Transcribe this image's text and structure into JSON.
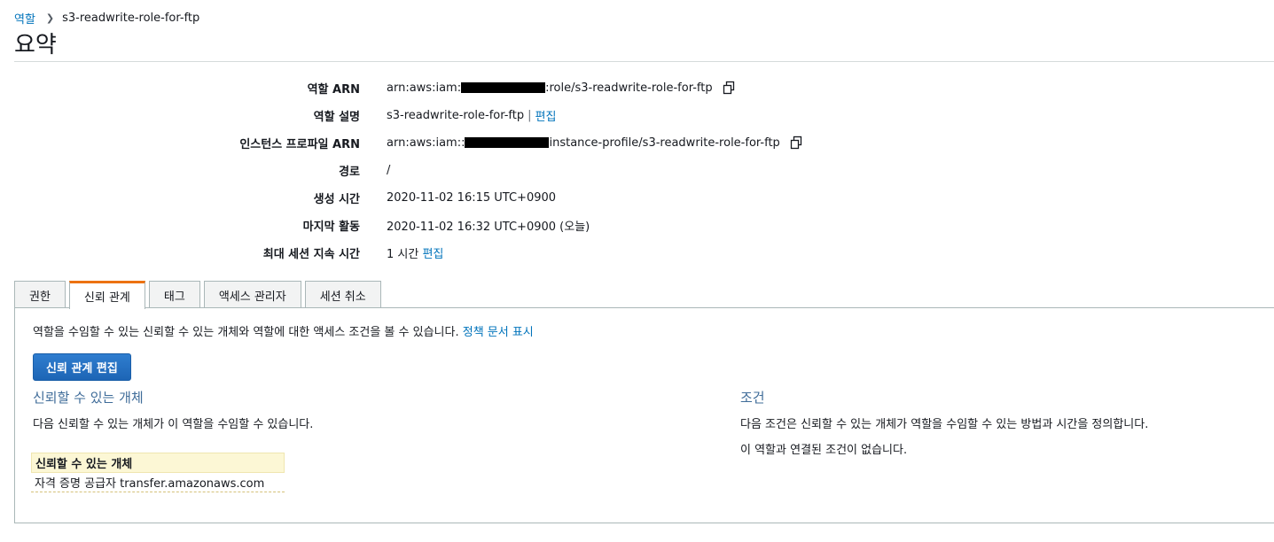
{
  "breadcrumb": {
    "parent": "역할",
    "current": "s3-readwrite-role-for-ftp"
  },
  "page_title": "요약",
  "summary": {
    "role_arn": {
      "label": "역할 ARN",
      "prefix": "arn:aws:iam:",
      "suffix": ":role/s3-readwrite-role-for-ftp"
    },
    "role_desc": {
      "label": "역할 설명",
      "value": "s3-readwrite-role-for-ftp",
      "pipe": "|",
      "edit": "편집"
    },
    "instance_profile_arn": {
      "label": "인스턴스 프로파일 ARN",
      "prefix": "arn:aws:iam::",
      "suffix": "instance-profile/s3-readwrite-role-for-ftp"
    },
    "path": {
      "label": "경로",
      "value": "/"
    },
    "created": {
      "label": "생성 시간",
      "value": "2020-11-02 16:15 UTC+0900"
    },
    "last_activity": {
      "label": "마지막 활동",
      "value": "2020-11-02 16:32 UTC+0900 (오늘)"
    },
    "max_session": {
      "label": "최대 세션 지속 시간",
      "value": "1 시간",
      "edit": "편집"
    }
  },
  "tabs": [
    "권한",
    "신뢰 관계",
    "태그",
    "액세스 관리자",
    "세션 취소"
  ],
  "active_tab": "신뢰 관계",
  "trust": {
    "intro": "역할을 수임할 수 있는 신뢰할 수 있는 개체와 역할에 대한 액세스 조건을 볼 수 있습니다.",
    "policy_link": "정책 문서 표시",
    "edit_button": "신뢰 관계 편집",
    "entities_title": "신뢰할 수 있는 개체",
    "entities_desc": "다음 신뢰할 수 있는 개체가 이 역할을 수임할 수 있습니다.",
    "table_header": "신뢰할 수 있는 개체",
    "table_row": "자격 증명 공급자 transfer.amazonaws.com",
    "conditions_title": "조건",
    "conditions_desc": "다음 조건은 신뢰할 수 있는 개체가 역할을 수임할 수 있는 방법과 시간을 정의합니다.",
    "conditions_none": "이 역할과 연결된 조건이 없습니다."
  },
  "colors": {
    "link": "#0073bb",
    "active_tab_accent": "#ec7211",
    "button": "#1d65b5",
    "section_title": "#3f6c99",
    "table_header_bg": "#fcf7d5"
  },
  "icons": {
    "copy": "copy-icon",
    "breadcrumb_separator": "chevron-right-icon"
  }
}
